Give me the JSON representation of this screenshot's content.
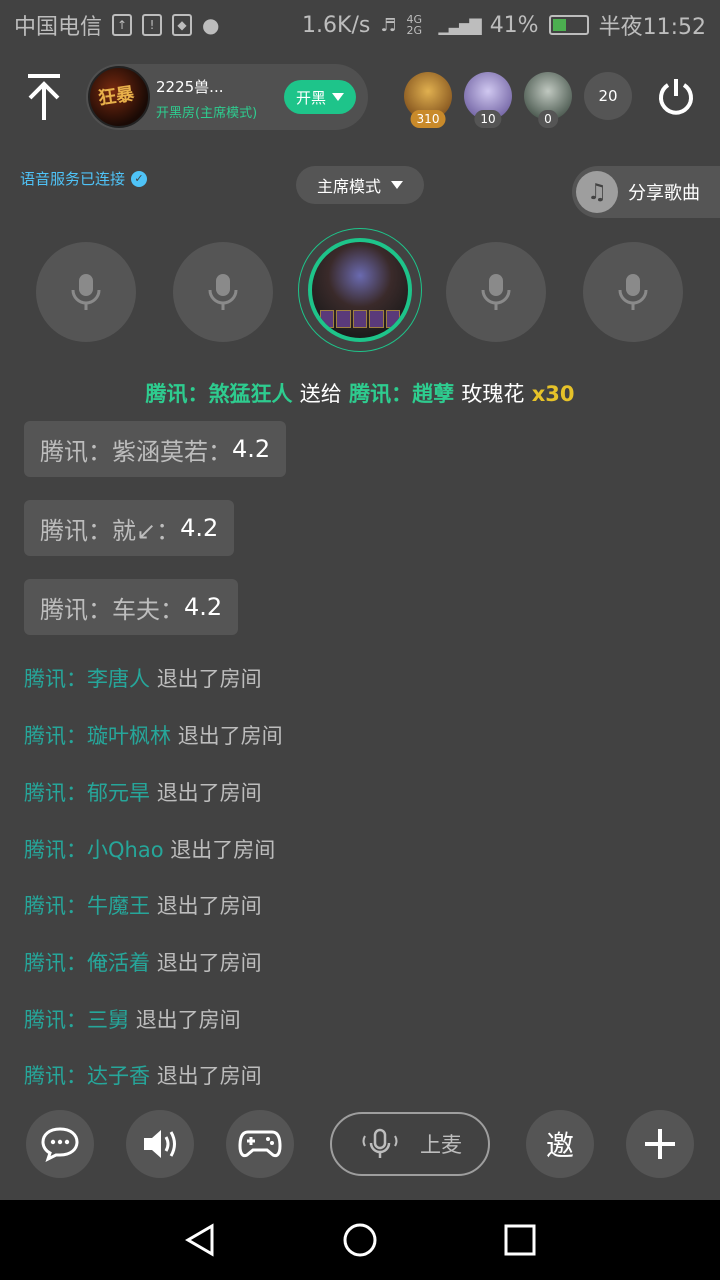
{
  "status_bar": {
    "carrier": "中国电信",
    "speed": "1.6K/s",
    "network": "4G 2G",
    "battery_pct": "41%",
    "battery_level": 0.41,
    "time": "半夜11:52"
  },
  "header": {
    "room_name": "2225兽...",
    "room_sub": "开黑房(主席模式)",
    "room_type_btn": "开黑",
    "viewers": [
      {
        "badge": "310",
        "color": "#c98a2a"
      },
      {
        "badge": "10",
        "color": "#8a7ac0"
      },
      {
        "badge": "0",
        "color": "#4a6a5a"
      }
    ],
    "viewer_count": "20"
  },
  "voice_status": "语音服务已连接",
  "mode_select": "主席模式",
  "share_song": "分享歌曲",
  "gift": {
    "sender_prefix": "腾讯：",
    "sender": "煞猛狂人",
    "verb": "送给",
    "receiver_prefix": "腾讯：",
    "receiver": "趙孽",
    "item": "玫瑰花",
    "qty": "x30"
  },
  "ratings": [
    {
      "name": "腾讯：紫涵莫若：",
      "value": "4.2"
    },
    {
      "name": "腾讯：就↙：",
      "value": "4.2"
    },
    {
      "name": "腾讯：车夫：",
      "value": "4.2"
    }
  ],
  "system_messages": [
    {
      "prefix": "腾讯：",
      "user": "李唐人",
      "action": "退出了房间"
    },
    {
      "prefix": "腾讯：",
      "user": "璇叶枫林",
      "action": "退出了房间"
    },
    {
      "prefix": "腾讯：",
      "user": "郁元旱",
      "action": "退出了房间"
    },
    {
      "prefix": "腾讯：",
      "user": "小Qhao",
      "action": "退出了房间"
    },
    {
      "prefix": "腾讯：",
      "user": "牛魔王",
      "action": "退出了房间"
    },
    {
      "prefix": "腾讯：",
      "user": "俺活着",
      "action": "退出了房间"
    },
    {
      "prefix": "腾讯：",
      "user": "三舅",
      "action": "退出了房间"
    },
    {
      "prefix": "腾讯：",
      "user": "达子香",
      "action": "退出了房间"
    }
  ],
  "toolbar": {
    "shangmai": "上麦",
    "invite": "邀"
  },
  "colors": {
    "accent": "#1ec48a",
    "background": "#424242",
    "gift_qty": "#e6c229",
    "link": "#26a69a"
  }
}
